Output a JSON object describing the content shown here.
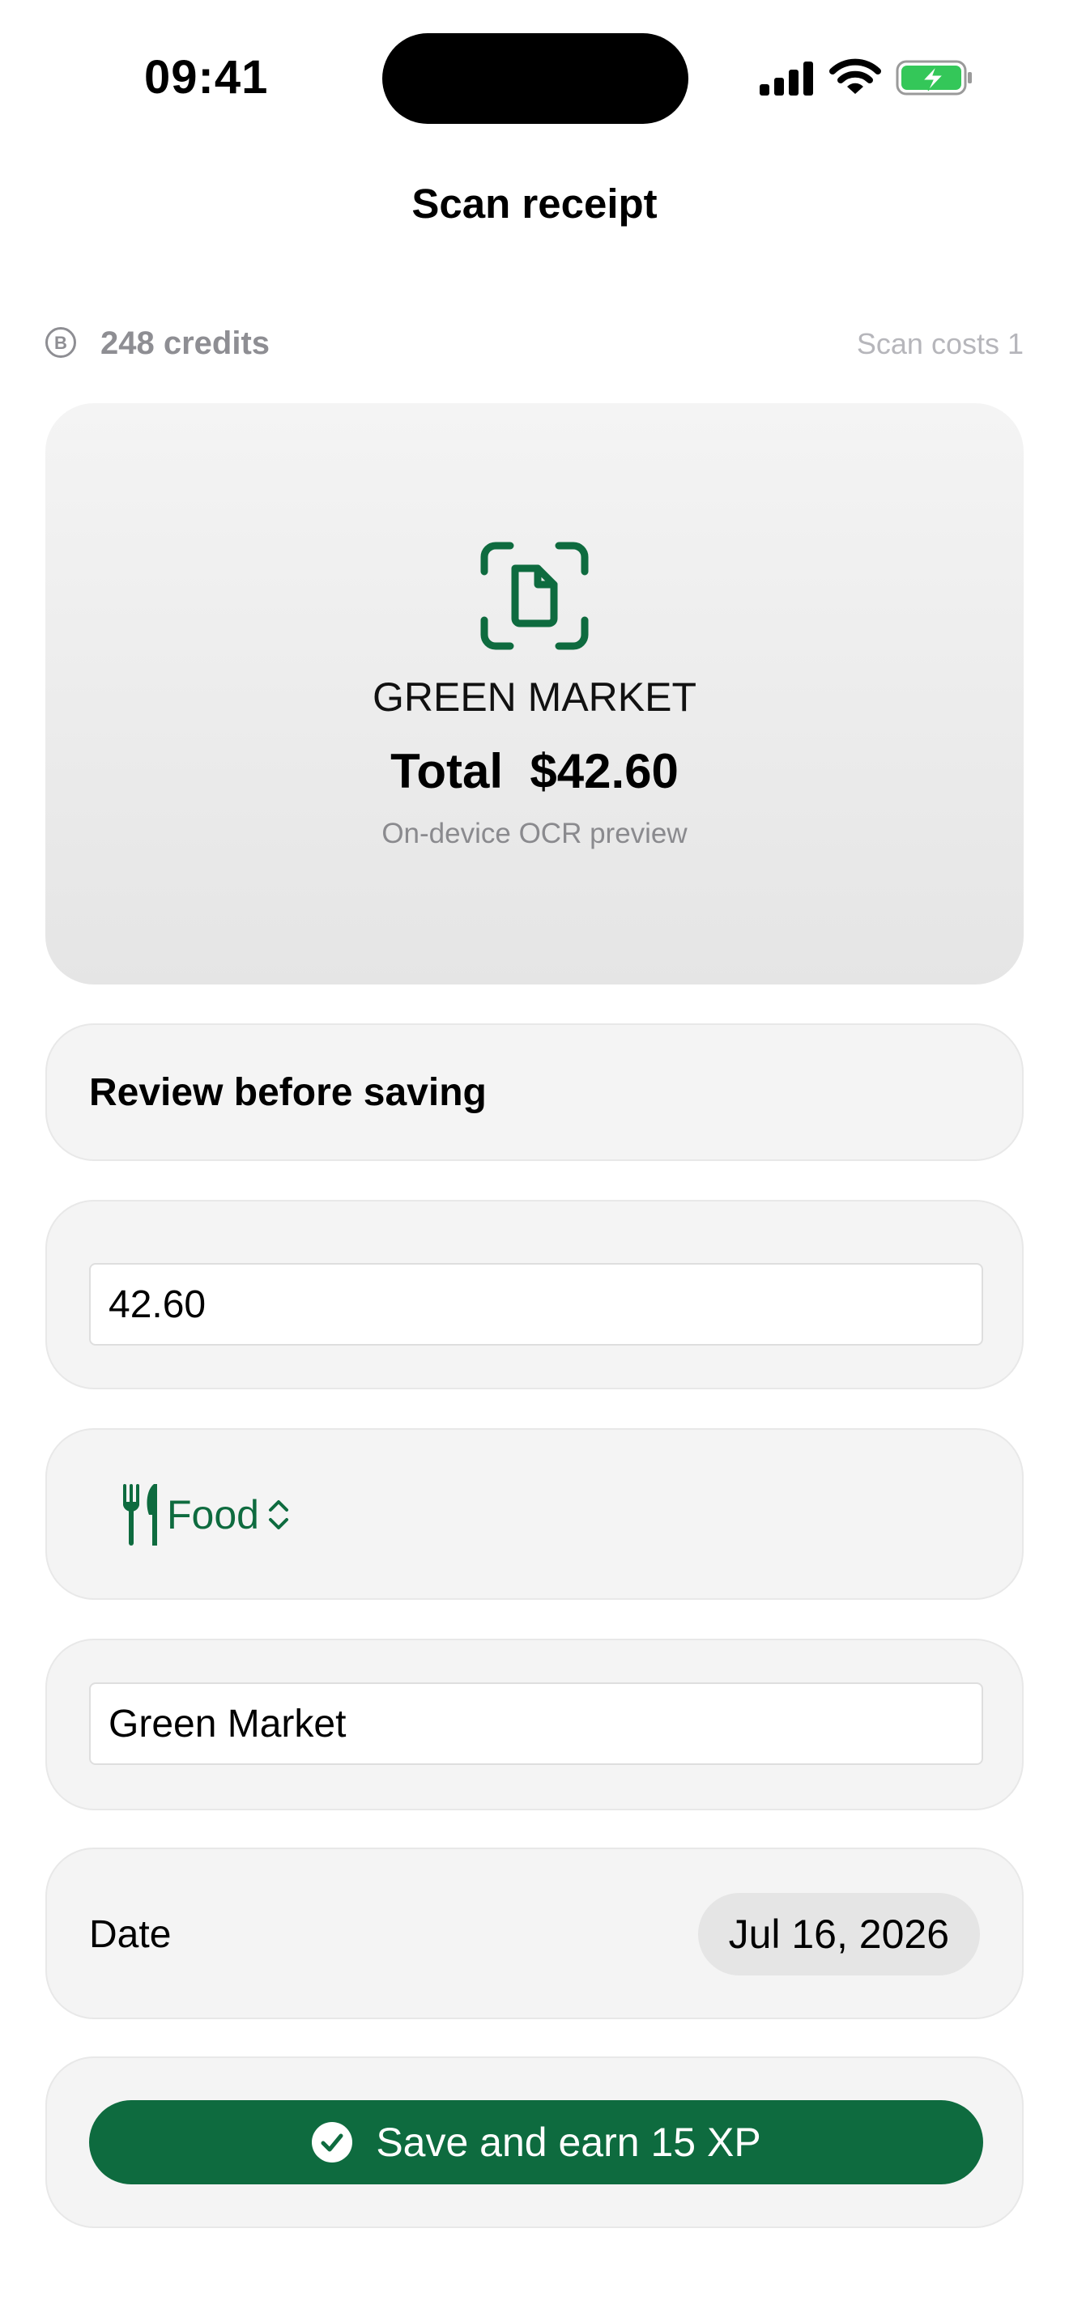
{
  "status_bar": {
    "time": "09:41",
    "icons": [
      "cellular-signal-icon",
      "wifi-icon",
      "battery-charging-icon"
    ],
    "battery_color": "#34c759"
  },
  "header": {
    "title": "Scan receipt"
  },
  "credits": {
    "icon": "coin-icon",
    "coin_symbol": "B",
    "label": "248 credits",
    "scan_cost": "Scan costs 1"
  },
  "preview": {
    "icon": "document-scan-icon",
    "merchant": "GREEN MARKET",
    "total": "Total  $42.60",
    "caption": "On-device OCR preview"
  },
  "review": {
    "title": "Review before saving"
  },
  "form": {
    "amount_value": "42.60",
    "category": {
      "icon": "fork-knife-icon",
      "label": "Food",
      "chevron": "chevron-up-down-icon"
    },
    "merchant_value": "Green Market",
    "date_label": "Date",
    "date_value": "Jul 16, 2026"
  },
  "save_button": {
    "icon": "checkmark-circle-icon",
    "label": "Save and earn 15 XP"
  },
  "colors": {
    "accent": "#0e6b3f",
    "card_bg": "#f4f4f4",
    "muted_text": "#8e8e93"
  }
}
